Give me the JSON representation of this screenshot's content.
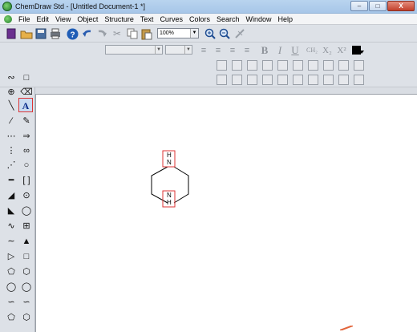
{
  "window": {
    "title": "ChemDraw Std - [Untitled Document-1 *]",
    "minimize": "‒",
    "restore": "□",
    "close": "X"
  },
  "menubar": {
    "items": [
      "File",
      "Edit",
      "View",
      "Object",
      "Structure",
      "Text",
      "Curves",
      "Colors",
      "Search",
      "Window",
      "Help"
    ]
  },
  "toolbar": {
    "zoom_value": "100%",
    "format": {
      "bold": "B",
      "italic": "I",
      "underline": "U",
      "chem": "CH₂",
      "subscript": "X₂",
      "superscript": "X²"
    },
    "text_color": "#000000"
  },
  "palette": {
    "text_tool_label": "A"
  },
  "molecule": {
    "top_atom": {
      "symbol": "N",
      "h": "H"
    },
    "bottom_atom": {
      "symbol": "N",
      "h": "H"
    }
  }
}
